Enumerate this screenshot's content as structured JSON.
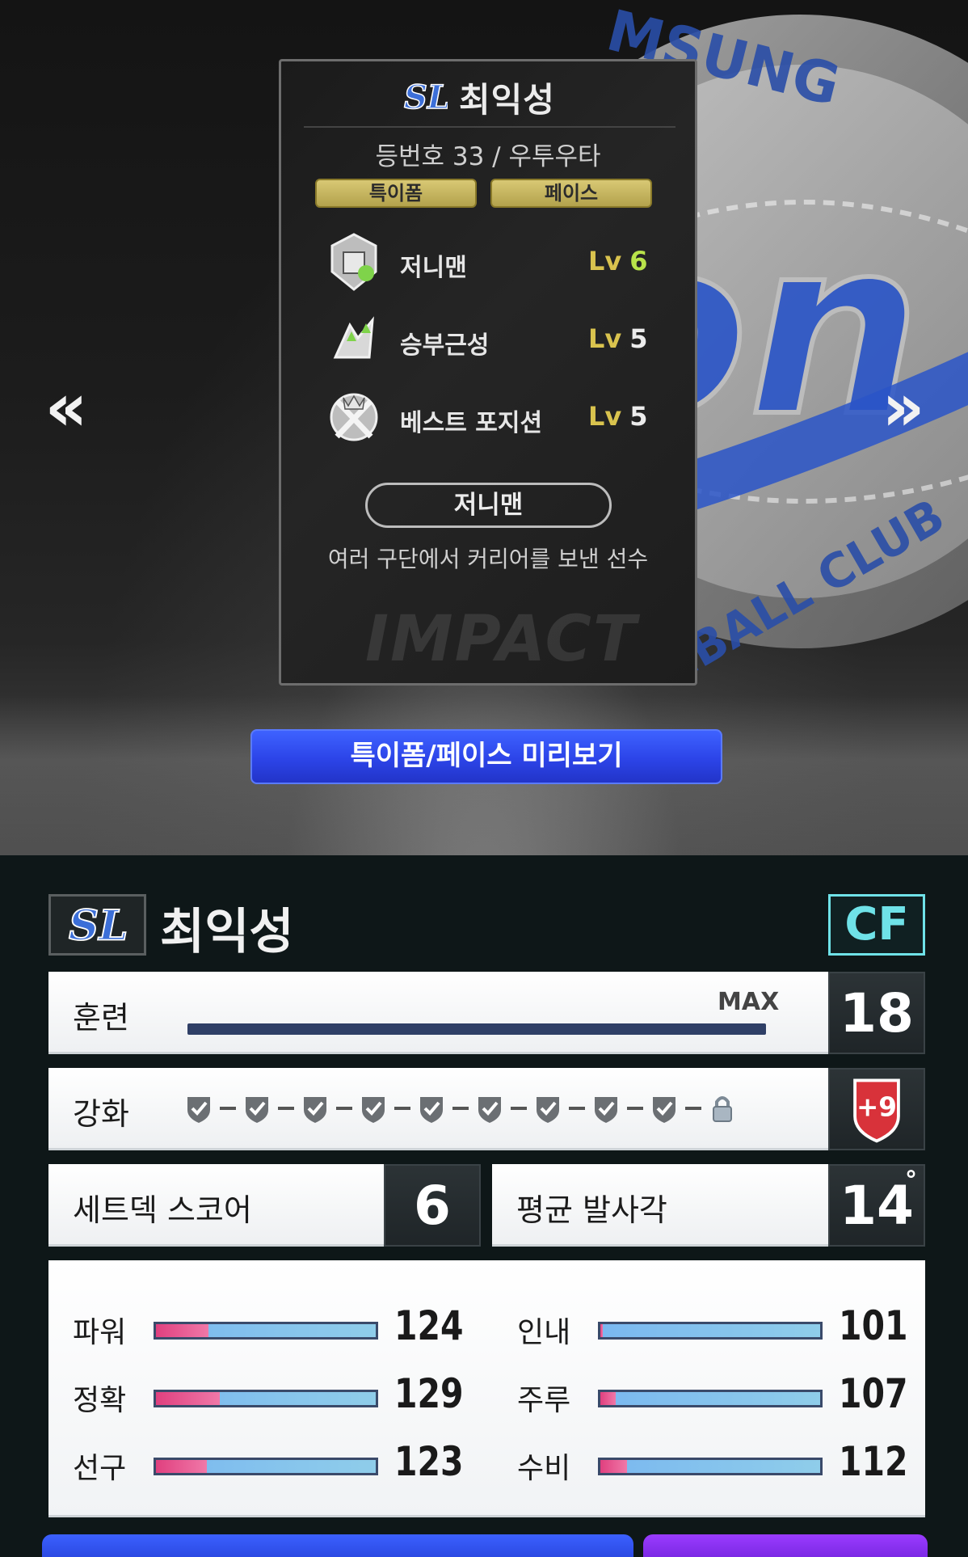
{
  "card": {
    "name": "최익성",
    "meta": "등번호 33 / 우투우타",
    "tags": [
      "특이폼",
      "페이스"
    ],
    "skills": [
      {
        "name": "저니맨",
        "lv_label": "Lv",
        "lv": "6",
        "icon": "journeyman-badge-icon"
      },
      {
        "name": "승부근성",
        "lv_label": "Lv",
        "lv": "5",
        "icon": "competitive-spirit-badge-icon"
      },
      {
        "name": "베스트 포지션",
        "lv_label": "Lv",
        "lv": "5",
        "icon": "best-position-badge-icon"
      }
    ],
    "trait_button": "저니맨",
    "trait_description": "여러 구단에서 커리어를 보낸 선수",
    "watermark": "IMPACT"
  },
  "nav": {
    "prev": "«",
    "next": "»"
  },
  "preview_button": "특이폼/페이스 미리보기",
  "player": {
    "name": "최익성",
    "position": "CF",
    "team_logo": "SL"
  },
  "training": {
    "label": "훈련",
    "max_label": "MAX",
    "value": "18",
    "progress": 1.0
  },
  "upgrade": {
    "label": "강화",
    "level": "+9",
    "checked_steps": 9,
    "locked_steps": 1
  },
  "setdeck": {
    "label": "세트덱 스코어",
    "value": "6"
  },
  "launch_angle": {
    "label": "평균 발사각",
    "value": "14",
    "unit": "°"
  },
  "stats": {
    "left": [
      {
        "label": "파워",
        "value": "124",
        "fill": 0.24
      },
      {
        "label": "정확",
        "value": "129",
        "fill": 0.29
      },
      {
        "label": "선구",
        "value": "123",
        "fill": 0.23
      }
    ],
    "right": [
      {
        "label": "인내",
        "value": "101",
        "fill": 0.01
      },
      {
        "label": "주루",
        "value": "107",
        "fill": 0.07
      },
      {
        "label": "수비",
        "value": "112",
        "fill": 0.12
      }
    ]
  },
  "colors": {
    "accent_blue": "#2c44e8",
    "position_cyan": "#6fe2e8",
    "level_gold": "#d9c34e",
    "upgrade_red": "#d8323a",
    "stat_pink": "#e0407f",
    "stat_blue": "#7ab8f0"
  }
}
